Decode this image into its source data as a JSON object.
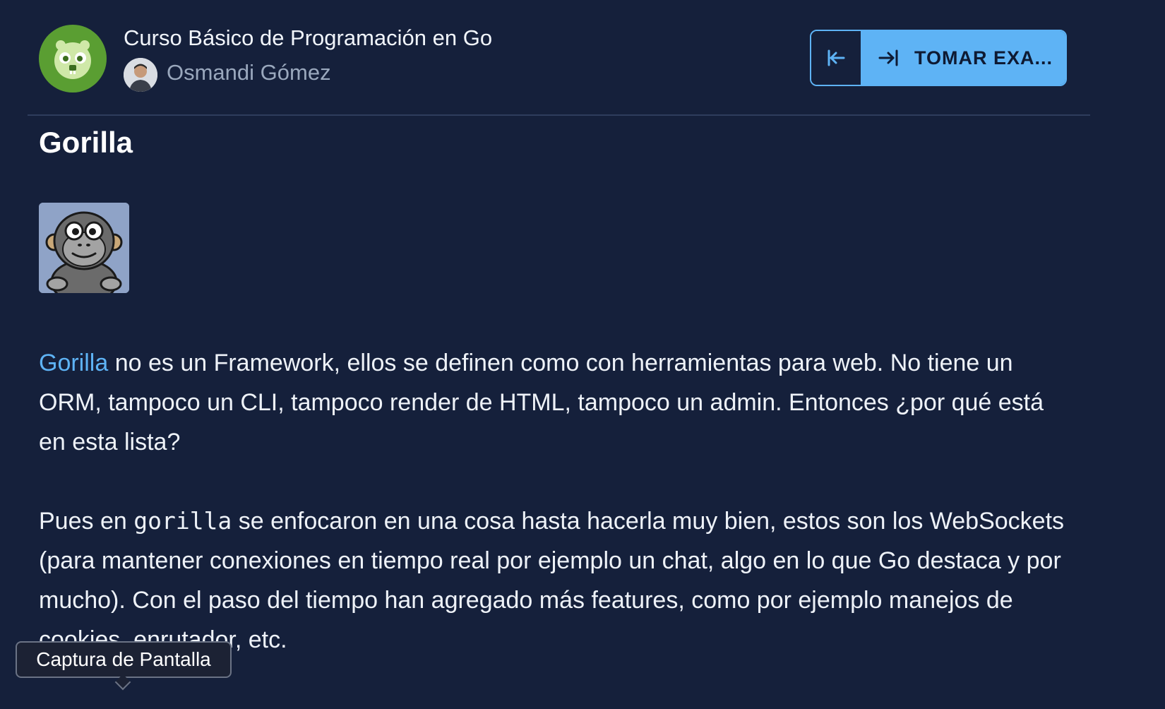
{
  "header": {
    "course_title": "Curso Básico de Programación en Go",
    "teacher_name": "Osmandi Gómez",
    "collapse_icon": "arrow-to-left-icon",
    "exam_icon": "arrow-to-right-icon",
    "exam_button_label": "TOMAR EXA..."
  },
  "lesson": {
    "title": "Gorilla",
    "image_icon": "gorilla-mascot-icon",
    "paragraph1": {
      "link_text": "Gorilla",
      "text": " no es un Framework, ellos se definen como con herramientas para web. No tiene un ORM, tampoco un CLI, tampoco render de HTML, tampoco un admin. Entonces ¿por qué está en esta lista?"
    },
    "paragraph2": {
      "text_before": "Pues en ",
      "code": "gorilla",
      "text_after": " se enfocaron en una cosa hasta hacerla muy bien, estos son los WebSockets (para mantener conexiones en tiempo real por ejemplo un chat, algo en lo que Go destaca y por mucho). Con el paso del tiempo han agregado más features, como por ejemplo manejos de cookies, enrutador, etc."
    }
  },
  "tooltip": {
    "text": "Captura de Pantalla"
  },
  "colors": {
    "background": "#15203b",
    "accent": "#5eb3f5",
    "logo_green": "#5a9e32"
  }
}
